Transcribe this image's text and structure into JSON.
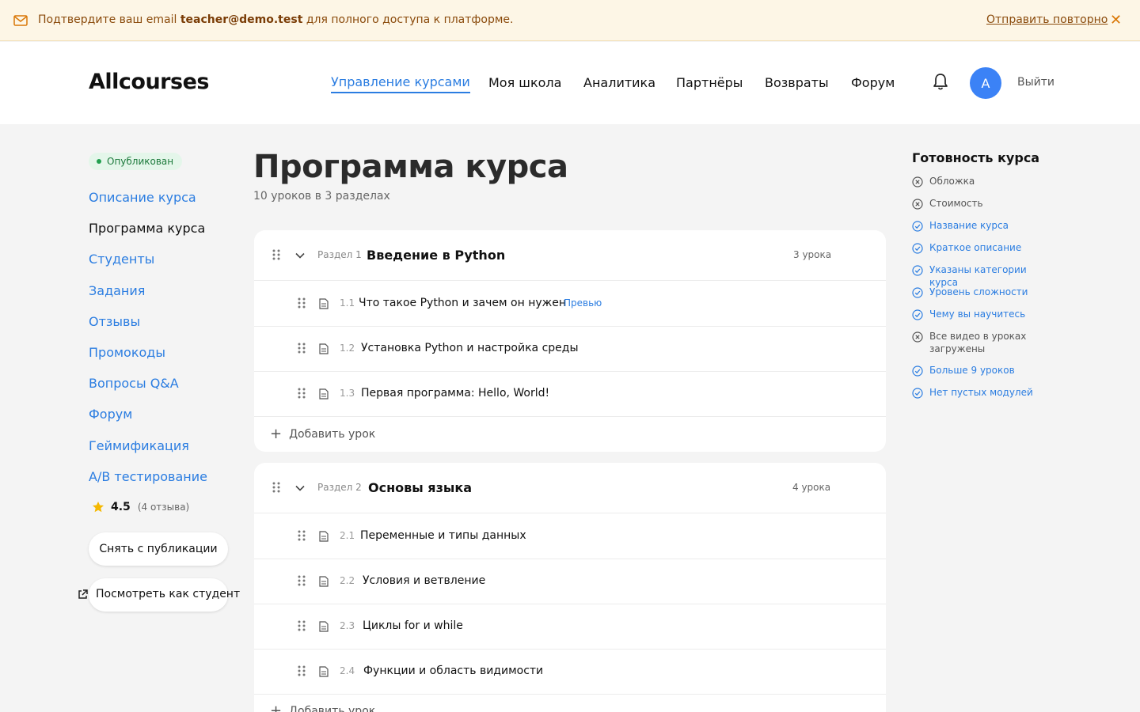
{
  "banner": {
    "message_before": "Подтвердите ваш email ",
    "email": "teacher@demo.test",
    "message_after": " для полного доступа к платформе.",
    "resend_label": "Отправить повторно",
    "close_glyph": "✕"
  },
  "header": {
    "logo": "Allcourses",
    "nav": [
      {
        "label": "Управление курсами",
        "active": true
      },
      {
        "label": "Моя школа",
        "active": false
      },
      {
        "label": "Аналитика",
        "active": false
      },
      {
        "label": "Партнёры",
        "active": false
      },
      {
        "label": "Возвраты",
        "active": false
      },
      {
        "label": "Форум",
        "active": false
      }
    ],
    "avatar_letter": "A",
    "logout_label": "Выйти"
  },
  "sidebar": {
    "status": "Опубликован",
    "links": [
      {
        "label": "Описание курса",
        "current": false
      },
      {
        "label": "Программа курса",
        "current": true
      },
      {
        "label": "Студенты",
        "current": false
      },
      {
        "label": "Задания",
        "current": false
      },
      {
        "label": "Отзывы",
        "current": false
      },
      {
        "label": "Промокоды",
        "current": false
      },
      {
        "label": "Вопросы Q&A",
        "current": false
      },
      {
        "label": "Форум",
        "current": false
      },
      {
        "label": "Геймификация",
        "current": false
      },
      {
        "label": "A/B тестирование",
        "current": false
      }
    ],
    "rating_value": "4.5",
    "rating_count": "(4 отзыва)",
    "unpublish_label": "Снять с публикации",
    "view_as_student_label": "Посмотреть как студент"
  },
  "main": {
    "title": "Программа курса",
    "subtitle": "10 уроков в 3 разделах",
    "sections": [
      {
        "number": "Раздел 1",
        "title": "Введение в Python",
        "count": "3 урока",
        "lessons": [
          {
            "number": "1.1",
            "title": "Что такое Python и зачем он нужен",
            "badge": "Превью"
          },
          {
            "number": "1.2",
            "title": "Установка Python и настройка среды"
          },
          {
            "number": "1.3",
            "title": "Первая программа: Hello, World!"
          }
        ],
        "add_label": "Добавить урок"
      },
      {
        "number": "Раздел 2",
        "title": "Основы языка",
        "count": "4 урока",
        "lessons": [
          {
            "number": "2.1",
            "title": "Переменные и типы данных"
          },
          {
            "number": "2.2",
            "title": "Условия и ветвление"
          },
          {
            "number": "2.3",
            "title": "Циклы for и while"
          },
          {
            "number": "2.4",
            "title": "Функции и область видимости"
          }
        ],
        "add_label": "Добавить урок"
      }
    ]
  },
  "readiness": {
    "title": "Готовность курса",
    "items": [
      {
        "label": "Обложка",
        "done": false
      },
      {
        "label": "Стоимость",
        "done": false
      },
      {
        "label": "Название курса",
        "done": true
      },
      {
        "label": "Краткое описание",
        "done": true
      },
      {
        "label": "Указаны категории курса",
        "done": true
      },
      {
        "label": "Уровень сложности",
        "done": true
      },
      {
        "label": "Чему вы научитесь",
        "done": true
      },
      {
        "label": "Все видео в уроках загружены",
        "done": false
      },
      {
        "label": "Больше 9 уроков",
        "done": true
      },
      {
        "label": "Нет пустых модулей",
        "done": true
      }
    ]
  },
  "colors": {
    "accent": "#2b7de1",
    "banner_bg": "#fdf6e6",
    "banner_text": "#8a4a0b",
    "published_green": "#22a050",
    "star": "#f5b800",
    "avatar": "#3b82f6"
  },
  "icons": {
    "banner": "mail-icon",
    "notifications": "bell-icon",
    "external": "external-link-icon",
    "drag": "drag-handle-icon",
    "collapse": "chevron-down-icon",
    "lesson": "document-icon",
    "done": "check-circle-icon",
    "todo": "x-circle-icon",
    "rating": "star-icon"
  }
}
